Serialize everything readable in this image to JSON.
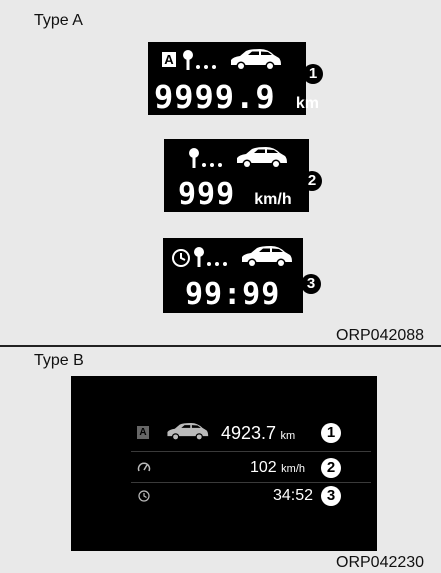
{
  "type_a": {
    "label": "Type A",
    "displays": [
      {
        "value": "9999.9",
        "unit": "km",
        "badge": "1",
        "mode_letter": "A"
      },
      {
        "value": "999",
        "unit": "km/h",
        "badge": "2"
      },
      {
        "value": "99:99",
        "unit": "",
        "badge": "3"
      }
    ],
    "figure_code": "ORP042088"
  },
  "type_b": {
    "label": "Type B",
    "rows": [
      {
        "mode_letter": "A",
        "value": "4923.7",
        "unit": "km",
        "badge": "1"
      },
      {
        "value": "102",
        "unit": "km/h",
        "badge": "2"
      },
      {
        "value": "34:52",
        "unit": "",
        "badge": "3"
      }
    ],
    "figure_code": "ORP042230"
  },
  "icons": [
    "pin-icon",
    "car-icon",
    "clock-icon",
    "speedometer-icon"
  ]
}
